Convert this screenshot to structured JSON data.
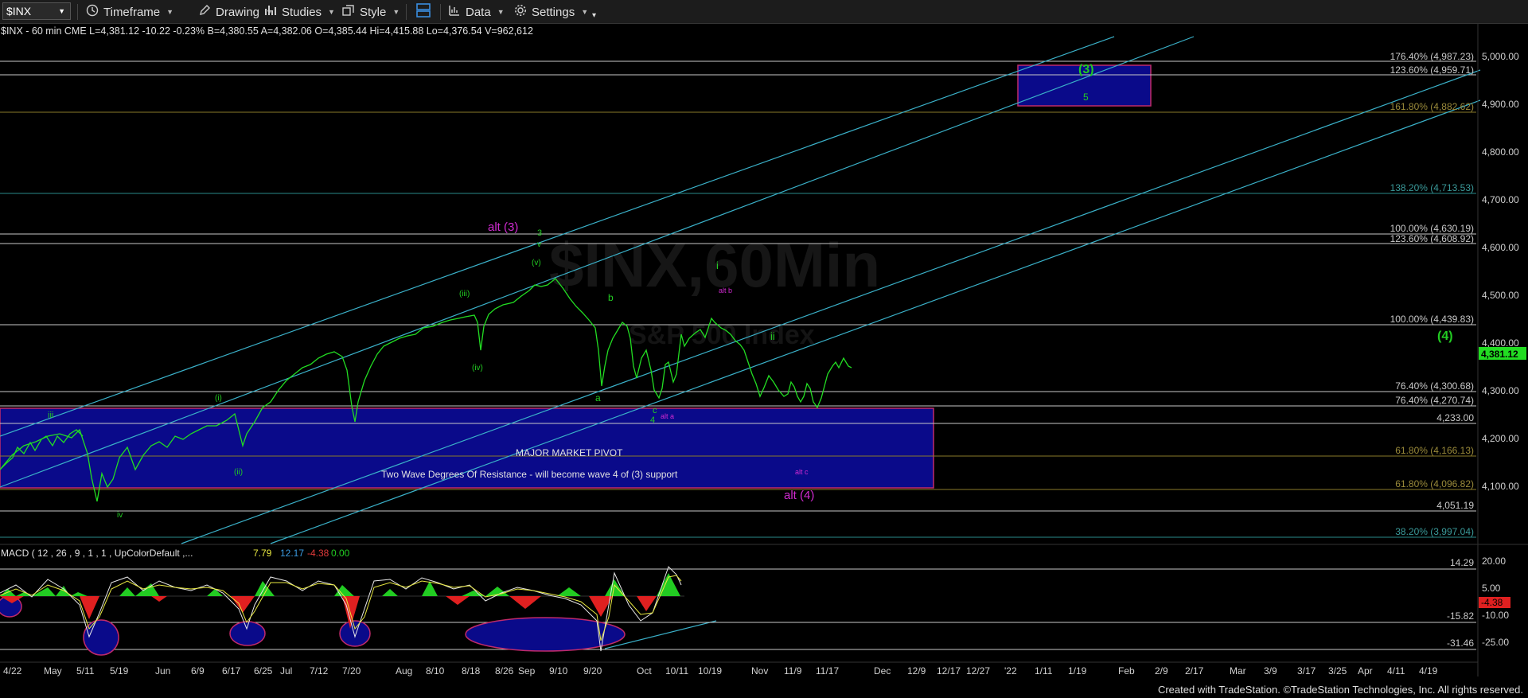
{
  "toolbar": {
    "symbol": "$INX",
    "timeframe": "Timeframe",
    "drawing": "Drawing",
    "studies": "Studies",
    "style": "Style",
    "data": "Data",
    "settings": "Settings"
  },
  "header": {
    "text": "$INX - 60 min  CME  L=4,381.12 -10.22 -0.23%  B=4,380.55  A=4,382.06  O=4,385.44  Hi=4,415.88  Lo=4,376.54  V=962,612"
  },
  "watermark": {
    "symbol": "$INX,60Min",
    "name": "S&P 500 Index"
  },
  "price_axis": {
    "ticks": [
      "5,000.00",
      "4,900.00",
      "4,800.00",
      "4,700.00",
      "4,600.00",
      "4,500.00",
      "4,400.00",
      "4,300.00",
      "4,200.00",
      "4,100.00"
    ],
    "last_price": "4,381.12"
  },
  "fib_levels": [
    {
      "label": "176.40% (4,987.23)",
      "color": "#b0b0b0"
    },
    {
      "label": "123.60% (4,959.71)",
      "color": "#b0b0b0"
    },
    {
      "label": "161.80% (4,882.62)",
      "color": "#9a8a3a"
    },
    {
      "label": "138.20% (4,713.53)",
      "color": "#3a9a9a"
    },
    {
      "label": "100.00% (4,630.19)",
      "color": "#b0b0b0"
    },
    {
      "label": "123.60% (4,608.92)",
      "color": "#b0b0b0"
    },
    {
      "label": "100.00% (4,439.83)",
      "color": "#b0b0b0"
    },
    {
      "label": "76.40% (4,300.68)",
      "color": "#b0b0b0"
    },
    {
      "label": "76.40% (4,270.74)",
      "color": "#b0b0b0"
    },
    {
      "label": "4,233.00",
      "color": "#b0b0b0"
    },
    {
      "label": "61.80% (4,166.13)",
      "color": "#9a8a3a"
    },
    {
      "label": "61.80% (4,096.82)",
      "color": "#9a8a3a"
    },
    {
      "label": "4,051.19",
      "color": "#b0b0b0"
    },
    {
      "label": "38.20% (3,997.04)",
      "color": "#3a9a9a"
    }
  ],
  "annotations": {
    "wave3": "(3)",
    "five": "5",
    "wave4": "(4)",
    "alt3": "alt (3)",
    "three": "3",
    "v_lower": "v",
    "v_paren": "(v)",
    "iii_paren": "(iii)",
    "iv_paren": "(iv)",
    "i_paren": "(i)",
    "ii_paren": "(ii)",
    "iii": "iii",
    "iv": "iv",
    "b": "b",
    "a": "a",
    "c": "c",
    "four": "4",
    "i": "i",
    "ii": "ii",
    "alt_b": "alt b",
    "alt_a": "alt a",
    "alt_c": "alt c",
    "alt4": "alt (4)",
    "pivot_title": "MAJOR MARKET PIVOT",
    "pivot_sub": "Two Wave Degrees Of Resistance - will become wave 4 of (3) support"
  },
  "macd": {
    "label": "MACD ( 12 , 26 , 9 , 1 , 1 , UpColorDefault ,...",
    "v1": "7.79",
    "v2": "12.17",
    "v3": "-4.38",
    "v4": "0.00",
    "ticks": [
      "20.00",
      "5.00",
      "-10.00",
      "-25.00"
    ],
    "level_labels": [
      "14.29",
      "-15.82",
      "-31.46"
    ],
    "current": "-4.38"
  },
  "x_axis": [
    "4/22",
    "May",
    "5/11",
    "5/19",
    "Jun",
    "6/9",
    "6/17",
    "6/25",
    "Jul",
    "7/12",
    "7/20",
    "Aug",
    "8/10",
    "8/18",
    "8/26",
    "Sep",
    "9/10",
    "9/20",
    "Oct",
    "10/11",
    "10/19",
    "Nov",
    "11/9",
    "11/17",
    "Dec",
    "12/9",
    "12/17",
    "12/27",
    "'22",
    "1/11",
    "1/19",
    "Feb",
    "2/9",
    "2/17",
    "Mar",
    "3/9",
    "3/17",
    "3/25",
    "Apr",
    "4/11",
    "4/19"
  ],
  "footer": "Created with TradeStation. ©TradeStation Technologies, Inc. All rights reserved.",
  "colors": {
    "price": "#22dd22",
    "box": "#0a0a8a",
    "channel": "#3ab0c8",
    "magenta": "#d02ad0",
    "green_label": "#22cc22"
  }
}
